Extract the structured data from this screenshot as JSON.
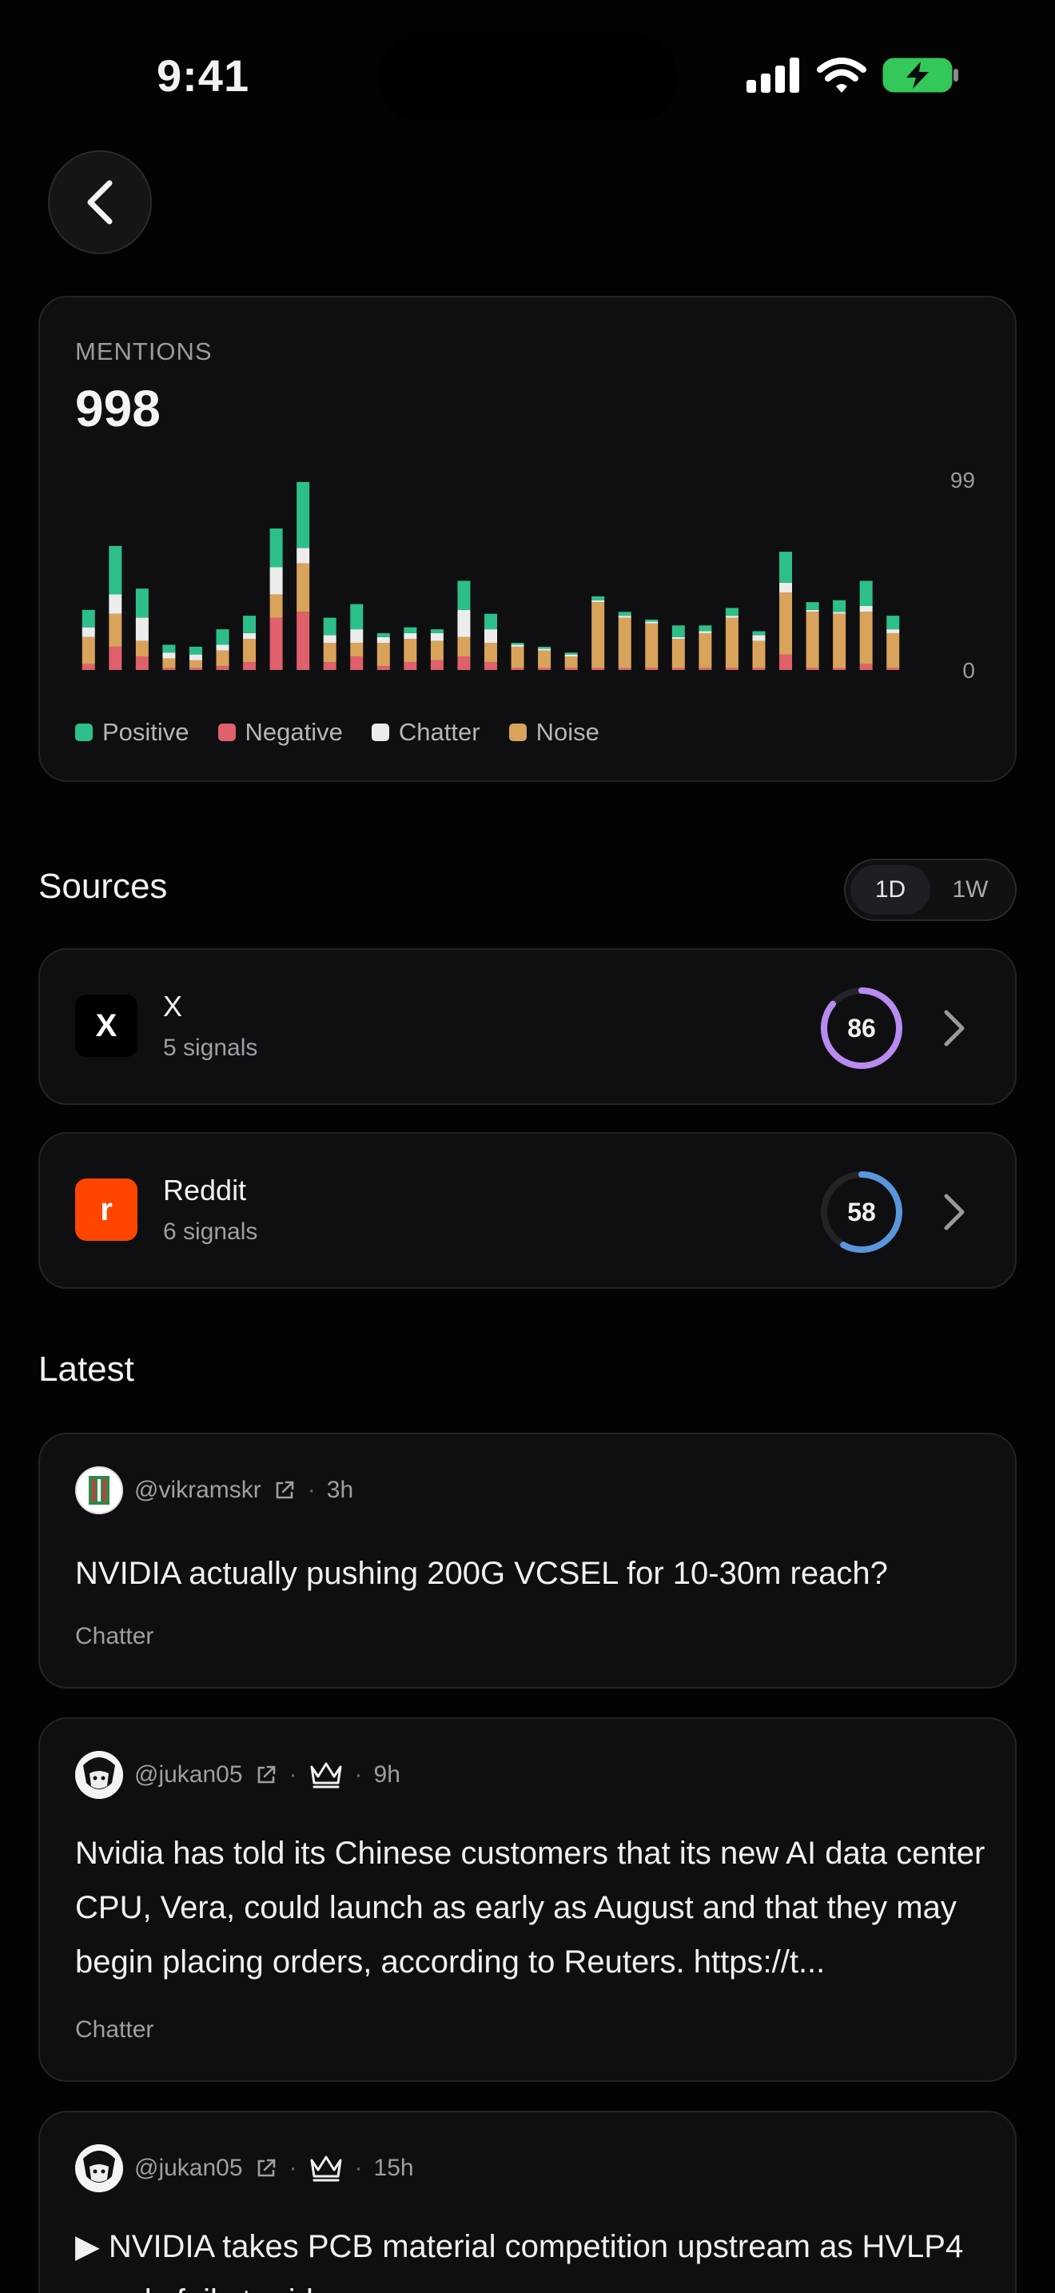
{
  "status": {
    "time": "9:41"
  },
  "mentions": {
    "label": "MENTIONS",
    "value": "998"
  },
  "colors": {
    "positive": "#2dbf8a",
    "negative": "#e0606c",
    "chatter": "#ececec",
    "noise": "#d9a35c",
    "x_ring": "#b98af0",
    "reddit_ring": "#5a96dc",
    "reddit": "#ff4500"
  },
  "chart_data": {
    "type": "bar",
    "stacked": true,
    "ylim": [
      0,
      99
    ],
    "y_ticks": [
      "99",
      "0"
    ],
    "series": [
      {
        "name": "Positive",
        "values": [
          9,
          25,
          15,
          4,
          4,
          8,
          9,
          20,
          34,
          9,
          13,
          2,
          3,
          2,
          15,
          8,
          1,
          1,
          1,
          2,
          2,
          1,
          6,
          3,
          4,
          2,
          16,
          4,
          6,
          13,
          7
        ]
      },
      {
        "name": "Negative",
        "values": [
          3,
          12,
          7,
          1,
          1,
          2,
          4,
          27,
          30,
          4,
          7,
          2,
          4,
          5,
          7,
          4,
          1,
          1,
          1,
          1,
          1,
          1,
          1,
          1,
          1,
          1,
          8,
          1,
          1,
          3,
          1
        ]
      },
      {
        "name": "Chatter",
        "values": [
          5,
          10,
          12,
          3,
          3,
          3,
          3,
          14,
          8,
          4,
          7,
          3,
          3,
          4,
          14,
          7,
          1,
          1,
          1,
          1,
          1,
          1,
          1,
          1,
          1,
          3,
          5,
          1,
          1,
          3,
          2
        ]
      },
      {
        "name": "Noise",
        "values": [
          14,
          17,
          8,
          5,
          4,
          8,
          12,
          12,
          25,
          10,
          7,
          12,
          12,
          10,
          10,
          10,
          11,
          9,
          6,
          34,
          26,
          23,
          15,
          18,
          26,
          14,
          32,
          29,
          28,
          27,
          18
        ]
      }
    ],
    "legend": [
      "Positive",
      "Negative",
      "Chatter",
      "Noise"
    ]
  },
  "sources": {
    "title": "Sources",
    "toggle": [
      "1D",
      "1W"
    ],
    "toggle_active": "1D",
    "items": [
      {
        "logo": "X",
        "name": "X",
        "signals": "5 signals",
        "score": "86",
        "score_value": 86
      },
      {
        "logo": "r",
        "name": "Reddit",
        "signals": "6 signals",
        "score": "58",
        "score_value": 58
      }
    ]
  },
  "latest": {
    "title": "Latest",
    "posts": [
      {
        "handle": "@vikramskr",
        "age": "3h",
        "verified": false,
        "text": "NVIDIA actually pushing 200G VCSEL for 10-30m reach?",
        "tag": "Chatter"
      },
      {
        "handle": "@jukan05",
        "age": "9h",
        "verified": true,
        "text": "Nvidia has told its Chinese customers that its new AI data center CPU, Vera, could launch as early as August and that they may begin placing orders, according to Reuters. https://t...",
        "tag": "Chatter"
      },
      {
        "handle": "@jukan05",
        "age": "15h",
        "verified": true,
        "text": "▶ NVIDIA takes PCB material competition upstream as HVLP4 supply fails to ride...",
        "tag": ""
      }
    ]
  }
}
